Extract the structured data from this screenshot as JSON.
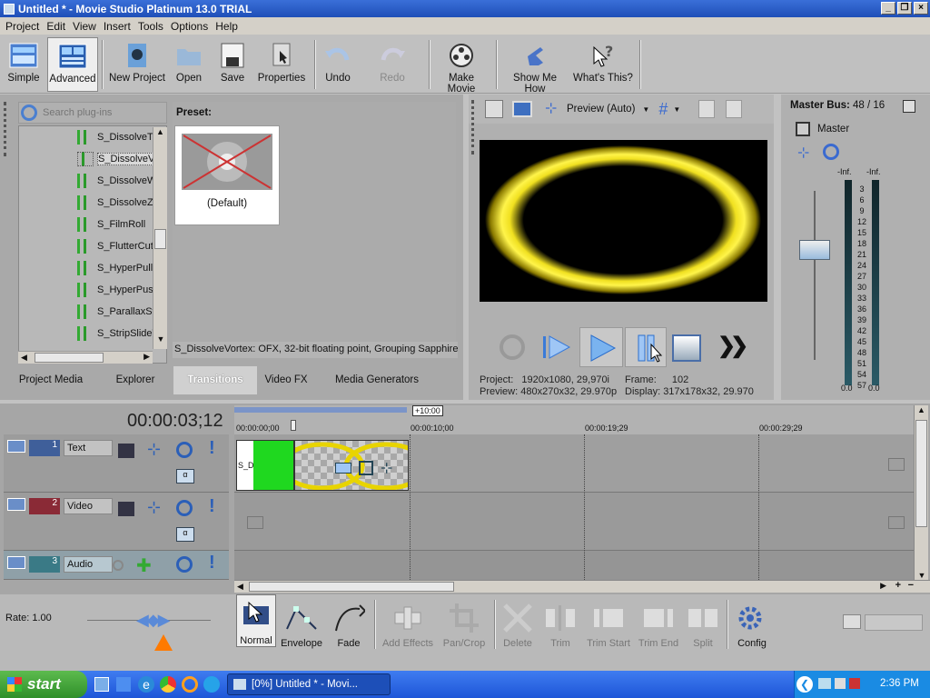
{
  "window": {
    "title": "Untitled * - Movie Studio Platinum 13.0 TRIAL"
  },
  "menu": [
    "Project",
    "Edit",
    "View",
    "Insert",
    "Tools",
    "Options",
    "Help"
  ],
  "toolbar": {
    "simple": "Simple",
    "advanced": "Advanced",
    "new_project": "New Project",
    "open": "Open",
    "save": "Save",
    "properties": "Properties",
    "undo": "Undo",
    "redo": "Redo",
    "make_movie": "Make Movie",
    "show_me_how": "Show Me How",
    "whats_this": "What's This?"
  },
  "plugins": {
    "search_placeholder": "Search plug-ins",
    "items": [
      "S_DissolveTil",
      "S_DissolveVo",
      "S_DissolveWa",
      "S_DissolveZa",
      "S_FilmRoll",
      "S_FlutterCut",
      "S_HyperPull",
      "S_HyperPush",
      "S_ParallaxStr",
      "S_StripSlideT"
    ],
    "selected_index": 1
  },
  "preset": {
    "label": "Preset:",
    "default": "(Default)",
    "description": "S_DissolveVortex: OFX, 32-bit floating point, Grouping  Sapphire"
  },
  "tabs": [
    "Project Media",
    "Explorer",
    "Transitions",
    "Video FX",
    "Media Generators"
  ],
  "preview": {
    "mode": "Preview (Auto)",
    "project_label": "Project:",
    "project_value": "1920x1080, 29,970i",
    "preview_label": "Preview:",
    "preview_value": "480x270x32, 29.970p",
    "frame_label": "Frame:",
    "frame_value": "102",
    "display_label": "Display:",
    "display_value": "317x178x32, 29.970"
  },
  "master": {
    "title": "Master Bus:",
    "value": "48 / 16",
    "label": "Master",
    "inf_left": "-Inf.",
    "inf_right": "-Inf.",
    "scale": [
      "3",
      "6",
      "9",
      "12",
      "15",
      "18",
      "21",
      "24",
      "27",
      "30",
      "33",
      "36",
      "39",
      "42",
      "45",
      "48",
      "51",
      "54",
      "57"
    ],
    "bottom_left": "0.0",
    "bottom_right": "0.0"
  },
  "timeline": {
    "timecode": "00:00:03;12",
    "marker": "+10:00",
    "ruler": [
      "00:00:00;00",
      "00:00:10;00",
      "00:00:19;29",
      "00:00:29;29"
    ],
    "tracks": [
      {
        "num": "1",
        "name": "Text"
      },
      {
        "num": "2",
        "name": "Video"
      },
      {
        "num": "3",
        "name": "Audio"
      }
    ],
    "clip_label": "S_D"
  },
  "rate": "Rate: 1.00",
  "bottom_tools": {
    "normal": "Normal",
    "envelope": "Envelope",
    "fade": "Fade",
    "add_effects": "Add Effects",
    "pan_crop": "Pan/Crop",
    "delete": "Delete",
    "trim": "Trim",
    "trim_start": "Trim Start",
    "trim_end": "Trim End",
    "split": "Split",
    "config": "Config"
  },
  "taskbar": {
    "start": "start",
    "task": "[0%] Untitled * - Movi...",
    "time": "2:36 PM"
  }
}
